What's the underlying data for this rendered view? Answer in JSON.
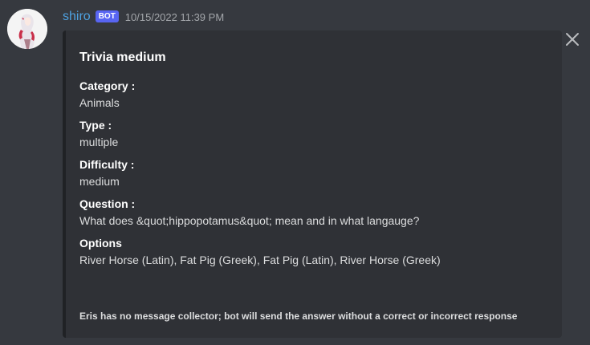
{
  "author": {
    "name": "shiro",
    "tag": "BOT",
    "timestamp": "10/15/2022 11:39 PM"
  },
  "embed": {
    "title": "Trivia medium",
    "fields": [
      {
        "name": "Category :",
        "value": "Animals"
      },
      {
        "name": "Type :",
        "value": "multiple"
      },
      {
        "name": "Difficulty :",
        "value": "medium"
      },
      {
        "name": "Question :",
        "value": "What does &quot;hippopotamus&quot; mean and in what langauge?"
      },
      {
        "name": "Options",
        "value": "River Horse (Latin), Fat Pig (Greek), Fat Pig (Latin), River Horse (Greek)"
      }
    ],
    "footer": "Eris has no message collector; bot will send the answer without a correct or incorrect response"
  },
  "colors": {
    "background": "#36393f",
    "embed_background": "#2f3136",
    "username": "#4ea1e0",
    "bot_tag": "#5865f2"
  },
  "icons": {
    "close": "close-icon",
    "avatar": "avatar"
  }
}
